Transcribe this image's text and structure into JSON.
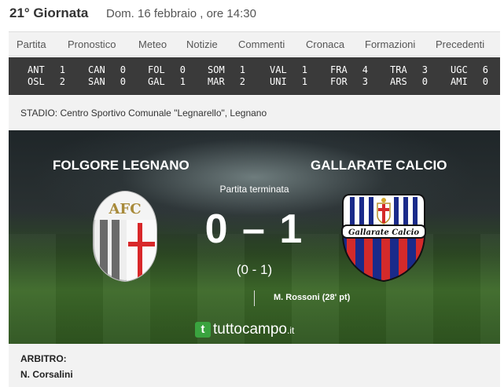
{
  "header": {
    "round": "21° Giornata",
    "date": "Dom. 16 febbraio , ore 14:30"
  },
  "tabs": [
    "Partita",
    "Pronostico",
    "Meteo",
    "Notizie",
    "Commenti",
    "Cronaca",
    "Formazioni",
    "Precedenti"
  ],
  "results": [
    {
      "home": "ANT",
      "home_score": "1",
      "away": "OSL",
      "away_score": "2"
    },
    {
      "home": "CAN",
      "home_score": "0",
      "away": "SAN",
      "away_score": "0"
    },
    {
      "home": "FOL",
      "home_score": "0",
      "away": "GAL",
      "away_score": "1"
    },
    {
      "home": "SOM",
      "home_score": "1",
      "away": "MAR",
      "away_score": "2"
    },
    {
      "home": "VAL",
      "home_score": "1",
      "away": "UNI",
      "away_score": "1"
    },
    {
      "home": "FRA",
      "home_score": "4",
      "away": "FOR",
      "away_score": "3"
    },
    {
      "home": "TRA",
      "home_score": "3",
      "away": "ARS",
      "away_score": "0"
    },
    {
      "home": "UGC",
      "home_score": "6",
      "away": "AMI",
      "away_score": "0"
    }
  ],
  "stadium": "STADIO: Centro Sportivo Comunale \"Legnarello\", Legnano",
  "match": {
    "home_team": "FOLGORE LEGNANO",
    "away_team": "GALLARATE CALCIO",
    "status": "Partita terminata",
    "score": "0 – 1",
    "halftime": "(0 - 1)",
    "scorer": "M. Rossoni (28' pt)",
    "home_crest_text": "AFC",
    "away_crest_text": "Gallarate Calcio"
  },
  "brand": {
    "t": "t",
    "name": "tuttocampo",
    "domain": ".it",
    "color": "#3aa33f"
  },
  "referee": {
    "label": "ARBITRO:",
    "name": "N. Corsalini"
  },
  "colors": {
    "results_bg": "#3a3a3a",
    "tab_bg": "#f2f2f2",
    "gallarate_blue": "#1a2a8a",
    "gallarate_red": "#d42a2a"
  }
}
